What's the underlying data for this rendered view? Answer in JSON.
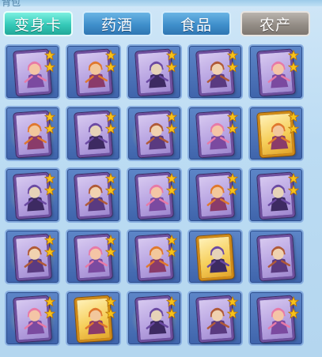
{
  "window": {
    "title_fragment": "背包"
  },
  "tabs": [
    {
      "label": "变身卡",
      "state": "active"
    },
    {
      "label": "药酒",
      "state": "normal"
    },
    {
      "label": "食品",
      "state": "normal"
    },
    {
      "label": "农产",
      "state": "disabled"
    }
  ],
  "colors": {
    "tab_active": "#35c9b8",
    "tab_normal": "#3f8fcb",
    "tab_disabled": "#948d86",
    "slot": "#4a72b8",
    "card_purple": "#b9a5e2",
    "card_gold": "#f6cf5b",
    "star": "#f7c21a"
  },
  "grid": {
    "rows": 5,
    "cols": 5,
    "items": [
      {
        "card": "purple",
        "stars": 2,
        "figure_icon": "pink-pig-character-icon",
        "glow": false
      },
      {
        "card": "purple",
        "stars": 2,
        "figure_icon": "fox-monk-character-icon",
        "glow": false
      },
      {
        "card": "purple",
        "stars": 2,
        "figure_icon": "fox-monk-character-icon",
        "glow": false
      },
      {
        "card": "purple",
        "stars": 2,
        "figure_icon": "warrior-with-staff-icon",
        "glow": false
      },
      {
        "card": "purple",
        "stars": 2,
        "figure_icon": "warrior-with-staff-icon",
        "glow": false
      },
      {
        "card": "purple",
        "stars": 2,
        "figure_icon": "purple-ninja-character-icon",
        "glow": true
      },
      {
        "card": "purple",
        "stars": 2,
        "figure_icon": "armored-general-icon",
        "glow": false
      },
      {
        "card": "purple",
        "stars": 2,
        "figure_icon": "armored-general-icon",
        "glow": true
      },
      {
        "card": "purple",
        "stars": 2,
        "figure_icon": "warrior-with-staff-icon",
        "glow": false
      },
      {
        "card": "gold",
        "stars": 2,
        "figure_icon": "fairy-girl-character-icon",
        "glow": false
      },
      {
        "card": "purple",
        "stars": 2,
        "figure_icon": "bat-demon-character-icon",
        "glow": true
      },
      {
        "card": "purple",
        "stars": 2,
        "figure_icon": "bat-demon-character-icon",
        "glow": false
      },
      {
        "card": "purple",
        "stars": 2,
        "figure_icon": "bat-demon-character-icon",
        "glow": false
      },
      {
        "card": "purple",
        "stars": 2,
        "figure_icon": "red-hair-dancer-icon",
        "glow": false
      },
      {
        "card": "purple",
        "stars": 2,
        "figure_icon": "red-hair-dancer-icon",
        "glow": false
      },
      {
        "card": "purple",
        "stars": 2,
        "figure_icon": "monkey-warrior-icon",
        "glow": true
      },
      {
        "card": "purple",
        "stars": 2,
        "figure_icon": "armored-general-icon",
        "glow": false
      },
      {
        "card": "purple",
        "stars": 2,
        "figure_icon": "armored-general-icon",
        "glow": true
      },
      {
        "card": "gold",
        "stars": 0,
        "figure_icon": "fire-beast-character-icon",
        "glow": false
      },
      {
        "card": "purple",
        "stars": 0,
        "figure_icon": "bat-demon-character-icon",
        "glow": false
      },
      {
        "card": "purple",
        "stars": 2,
        "figure_icon": "purple-ninja-character-icon",
        "glow": true
      },
      {
        "card": "gold",
        "stars": 2,
        "figure_icon": "blue-hat-mage-icon",
        "glow": false
      },
      {
        "card": "purple",
        "stars": 2,
        "figure_icon": "purple-ninja-character-icon",
        "glow": true
      },
      {
        "card": "purple",
        "stars": 2,
        "figure_icon": "warrior-with-staff-icon",
        "glow": false
      },
      {
        "card": "purple",
        "stars": 2,
        "figure_icon": "warrior-with-staff-icon",
        "glow": false
      }
    ]
  }
}
